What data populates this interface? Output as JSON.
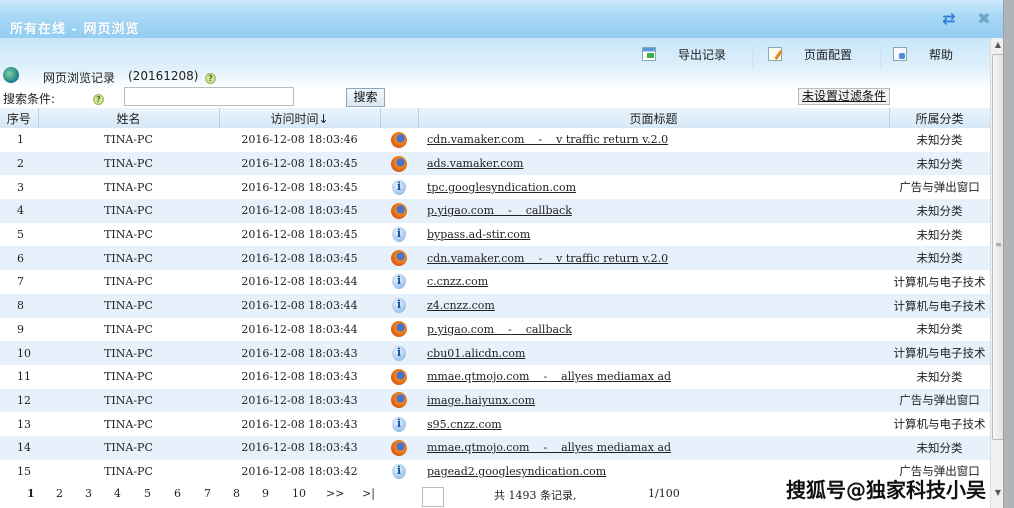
{
  "window": {
    "title": "所有在线 - 网页浏览",
    "refresh_icon": "refresh-icon",
    "close_icon": "close-icon"
  },
  "toolbar": {
    "export_label": "导出记录",
    "config_label": "页面配置",
    "help_label": "帮助"
  },
  "subheader": {
    "records_label": "网页浏览记录",
    "records_date": "(20161208)",
    "help_mark": "?"
  },
  "search": {
    "label": "搜索条件:",
    "help_mark": "?",
    "value": "",
    "placeholder": "",
    "button_label": "搜索",
    "filter_label": "未设置过滤条件"
  },
  "table": {
    "columns": [
      "序号",
      "姓名",
      "访问时间↓",
      "",
      "页面标题",
      "所属分类"
    ],
    "rows": [
      {
        "idx": "1",
        "name": "TINA-PC",
        "time": "2016-12-08 18:03:46",
        "icon": "firefox",
        "title": "cdn.vamaker.com    -    v traffic return v.2.0",
        "category": "未知分类"
      },
      {
        "idx": "2",
        "name": "TINA-PC",
        "time": "2016-12-08 18:03:45",
        "icon": "firefox",
        "title": "ads.vamaker.com",
        "category": "未知分类"
      },
      {
        "idx": "3",
        "name": "TINA-PC",
        "time": "2016-12-08 18:03:45",
        "icon": "info",
        "title": "tpc.googlesyndication.com",
        "category": "广告与弹出窗口"
      },
      {
        "idx": "4",
        "name": "TINA-PC",
        "time": "2016-12-08 18:03:45",
        "icon": "firefox",
        "title": "p.yigao.com    -    callback",
        "category": "未知分类"
      },
      {
        "idx": "5",
        "name": "TINA-PC",
        "time": "2016-12-08 18:03:45",
        "icon": "info",
        "title": "bypass.ad-stir.com",
        "category": "未知分类"
      },
      {
        "idx": "6",
        "name": "TINA-PC",
        "time": "2016-12-08 18:03:45",
        "icon": "firefox",
        "title": "cdn.vamaker.com    -    v traffic return v.2.0",
        "category": "未知分类"
      },
      {
        "idx": "7",
        "name": "TINA-PC",
        "time": "2016-12-08 18:03:44",
        "icon": "info",
        "title": "c.cnzz.com",
        "category": "计算机与电子技术"
      },
      {
        "idx": "8",
        "name": "TINA-PC",
        "time": "2016-12-08 18:03:44",
        "icon": "info",
        "title": "z4.cnzz.com",
        "category": "计算机与电子技术"
      },
      {
        "idx": "9",
        "name": "TINA-PC",
        "time": "2016-12-08 18:03:44",
        "icon": "firefox",
        "title": "p.yigao.com    -    callback",
        "category": "未知分类"
      },
      {
        "idx": "10",
        "name": "TINA-PC",
        "time": "2016-12-08 18:03:43",
        "icon": "info",
        "title": "cbu01.alicdn.com",
        "category": "计算机与电子技术"
      },
      {
        "idx": "11",
        "name": "TINA-PC",
        "time": "2016-12-08 18:03:43",
        "icon": "firefox",
        "title": "mmae.qtmojo.com    -    allyes mediamax ad",
        "category": "未知分类"
      },
      {
        "idx": "12",
        "name": "TINA-PC",
        "time": "2016-12-08 18:03:43",
        "icon": "firefox",
        "title": "image.haiyunx.com",
        "category": "广告与弹出窗口"
      },
      {
        "idx": "13",
        "name": "TINA-PC",
        "time": "2016-12-08 18:03:43",
        "icon": "info",
        "title": "s95.cnzz.com",
        "category": "计算机与电子技术"
      },
      {
        "idx": "14",
        "name": "TINA-PC",
        "time": "2016-12-08 18:03:43",
        "icon": "firefox",
        "title": "mmae.qtmojo.com    -    allyes mediamax ad",
        "category": "未知分类"
      },
      {
        "idx": "15",
        "name": "TINA-PC",
        "time": "2016-12-08 18:03:42",
        "icon": "info",
        "title": "pagead2.googlesyndication.com",
        "category": "广告与弹出窗口"
      }
    ]
  },
  "pager": {
    "pages": [
      "1",
      "2",
      "3",
      "4",
      "5",
      "6",
      "7",
      "8",
      "9",
      "10"
    ],
    "next": ">>",
    "last": ">|",
    "page_input": "",
    "total_text": "共 1493 条记录,",
    "page_info": "1/100"
  },
  "watermark": "搜狐号@独家科技小吴",
  "colors": {
    "titlebar": "#a9d9f6",
    "row_alt": "#e6f1fb",
    "header": "#d6e8f7"
  }
}
